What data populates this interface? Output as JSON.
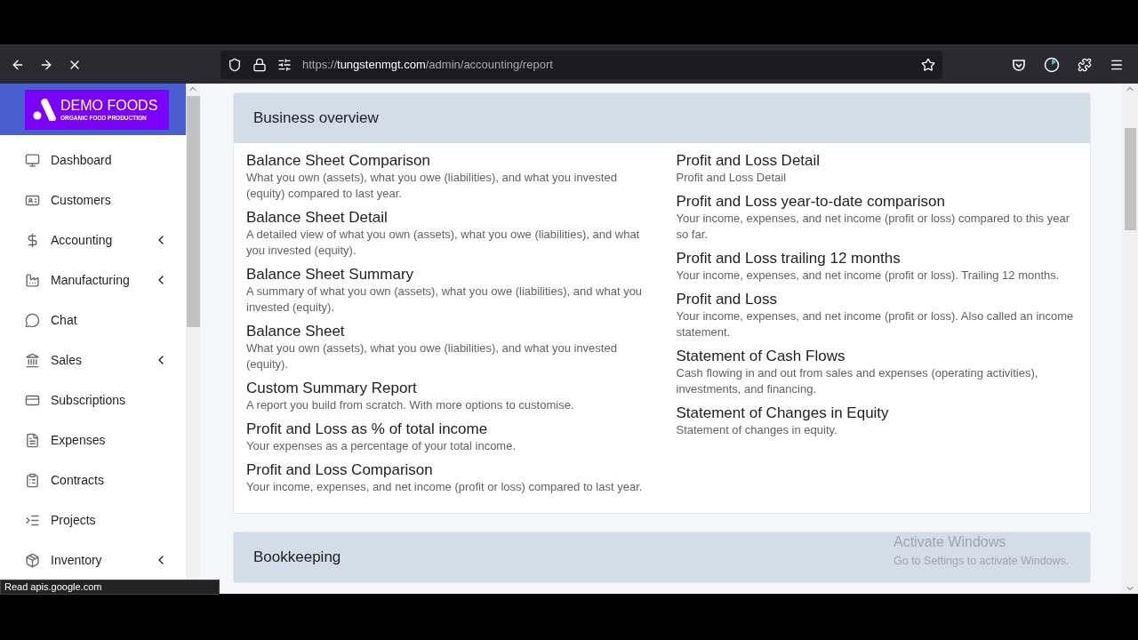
{
  "browser": {
    "url": {
      "scheme": "https://",
      "host": "tungstenmgt.com",
      "path": "/admin/accounting/report"
    },
    "status_text": "Read apis.google.com"
  },
  "logo": {
    "name": "DEMO FOODS",
    "tagline": "ORGANIC FOOD PRODUCTION"
  },
  "sidebar": {
    "items": [
      {
        "label": "Dashboard",
        "expandable": false
      },
      {
        "label": "Customers",
        "expandable": false
      },
      {
        "label": "Accounting",
        "expandable": true
      },
      {
        "label": "Manufacturing",
        "expandable": true
      },
      {
        "label": "Chat",
        "expandable": false
      },
      {
        "label": "Sales",
        "expandable": true
      },
      {
        "label": "Subscriptions",
        "expandable": false
      },
      {
        "label": "Expenses",
        "expandable": false
      },
      {
        "label": "Contracts",
        "expandable": false
      },
      {
        "label": "Projects",
        "expandable": false
      },
      {
        "label": "Inventory",
        "expandable": true
      }
    ]
  },
  "sections": [
    {
      "title": "Business overview",
      "columns": [
        [
          {
            "title": "Balance Sheet Comparison",
            "description": "What you own (assets), what you owe (liabilities), and what you invested (equity) compared to last year."
          },
          {
            "title": "Balance Sheet Detail",
            "description": "A detailed view of what you own (assets), what you owe (liabilities), and what you invested (equity)."
          },
          {
            "title": "Balance Sheet Summary",
            "description": "A summary of what you own (assets), what you owe (liabilities), and what you invested (equity)."
          },
          {
            "title": "Balance Sheet",
            "description": "What you own (assets), what you owe (liabilities), and what you invested (equity)."
          },
          {
            "title": "Custom Summary Report",
            "description": "A report you build from scratch. With more options to customise."
          },
          {
            "title": "Profit and Loss as % of total income",
            "description": "Your expenses as a percentage of your total income."
          },
          {
            "title": "Profit and Loss Comparison",
            "description": "Your income, expenses, and net income (profit or loss) compared to last year."
          }
        ],
        [
          {
            "title": "Profit and Loss Detail",
            "description": "Profit and Loss Detail"
          },
          {
            "title": "Profit and Loss year-to-date comparison",
            "description": "Your income, expenses, and net income (profit or loss) compared to this year so far."
          },
          {
            "title": "Profit and Loss trailing 12 months",
            "description": "Your income, expenses, and net income (profit or loss). Trailing 12 months."
          },
          {
            "title": "Profit and Loss",
            "description": "Your income, expenses, and net income (profit or loss). Also called an income statement."
          },
          {
            "title": "Statement of Cash Flows",
            "description": "Cash flowing in and out from sales and expenses (operating activities), investments, and financing."
          },
          {
            "title": "Statement of Changes in Equity",
            "description": "Statement of changes in equity."
          }
        ]
      ]
    },
    {
      "title": "Bookkeeping"
    }
  ],
  "os_notice": {
    "title": "Activate Windows",
    "text": "Go to Settings to activate Windows."
  }
}
